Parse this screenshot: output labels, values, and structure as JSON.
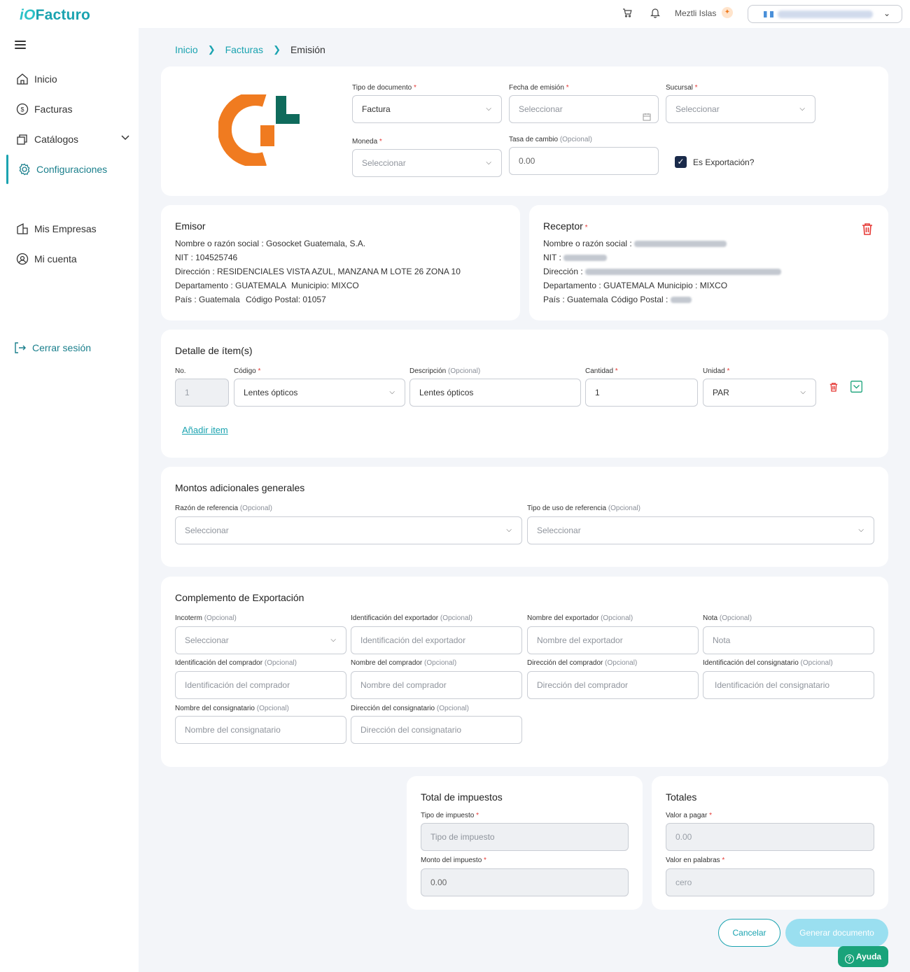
{
  "app": {
    "logo_prefix": "iO",
    "logo_text": "Facturo"
  },
  "header": {
    "user_name": "Meztli Islas",
    "company_name": "Gosocket Guatemala, S.A."
  },
  "sidebar": {
    "items": [
      {
        "label": "Inicio"
      },
      {
        "label": "Facturas"
      },
      {
        "label": "Catálogos"
      },
      {
        "label": "Configuraciones"
      },
      {
        "label": "Mis Empresas"
      },
      {
        "label": "Mi cuenta"
      }
    ],
    "logout": "Cerrar sesión"
  },
  "breadcrumb": [
    "Inicio",
    "Facturas",
    "Emisión"
  ],
  "doc": {
    "tipo_label": "Tipo de documento",
    "tipo_value": "Factura",
    "fecha_label": "Fecha de emisión",
    "fecha_placeholder": "Seleccionar",
    "sucursal_label": "Sucursal",
    "sucursal_placeholder": "Seleccionar",
    "moneda_label": "Moneda",
    "moneda_placeholder": "Seleccionar",
    "tasa_label": "Tasa de cambio",
    "tasa_value": "0.00",
    "opcional": "(Opcional)",
    "exportacion_label": "Es Exportación?"
  },
  "emisor": {
    "title": "Emisor",
    "nombre": "Nombre o razón social : Gosocket Guatemala, S.A.",
    "nit": "NIT : 104525746",
    "direccion": "Dirección : RESIDENCIALES VISTA AZUL, MANZANA M LOTE 26 ZONA 10",
    "departamento": "Departamento : GUATEMALA",
    "municipio": "Municipio: MIXCO",
    "pais": "País : Guatemala",
    "codigo_postal": "Código Postal: 01057"
  },
  "receptor": {
    "title": "Receptor",
    "nombre_label": "Nombre o razón social :",
    "nit_label": "NIT :",
    "direccion_label": "Dirección :",
    "departamento": "Departamento : GUATEMALA",
    "municipio": "Municipio : MIXCO",
    "pais": "País : Guatemala",
    "codigo_postal_label": "Código Postal :"
  },
  "items": {
    "title": "Detalle de ítem(s)",
    "col_no": "No.",
    "col_codigo": "Código",
    "col_descripcion": "Descripción",
    "col_cantidad": "Cantidad",
    "col_unidad": "Unidad",
    "row": {
      "no": "1",
      "codigo": "Lentes ópticos",
      "descripcion": "Lentes ópticos",
      "cantidad": "1",
      "unidad": "PAR"
    },
    "add_link": "Añadir item"
  },
  "montos": {
    "title": "Montos adicionales generales",
    "razon_label": "Razón de referencia",
    "razon_placeholder": "Seleccionar",
    "tipo_uso_label": "Tipo de uso de referencia",
    "tipo_uso_placeholder": "Seleccionar"
  },
  "export": {
    "title": "Complemento de Exportación",
    "fields": [
      {
        "label": "Incoterm",
        "placeholder": "Seleccionar"
      },
      {
        "label": "Identificación del exportador",
        "placeholder": "Identificación del exportador"
      },
      {
        "label": "Nombre del exportador",
        "placeholder": "Nombre del exportador"
      },
      {
        "label": "Nota",
        "placeholder": "Nota"
      },
      {
        "label": "Identificación del comprador",
        "placeholder": "Identificación del comprador"
      },
      {
        "label": "Nombre del comprador",
        "placeholder": "Nombre del comprador"
      },
      {
        "label": "Dirección del comprador",
        "placeholder": "Dirección del comprador"
      },
      {
        "label": "Identificación del consignatario",
        "placeholder": "Identificación del consignatario"
      },
      {
        "label": "Nombre del consignatario",
        "placeholder": "Nombre del consignatario"
      },
      {
        "label": "Dirección del consignatario",
        "placeholder": "Dirección del consignatario"
      }
    ]
  },
  "impuestos": {
    "title": "Total de impuestos",
    "tipo_label": "Tipo de impuesto",
    "tipo_placeholder": "Tipo de impuesto",
    "monto_label": "Monto del impuesto",
    "monto_value": "0.00"
  },
  "totales": {
    "title": "Totales",
    "valor_label": "Valor a pagar",
    "valor_value": "0.00",
    "palabras_label": "Valor en palabras",
    "palabras_value": "cero"
  },
  "actions": {
    "cancel": "Cancelar",
    "generate": "Generar documento",
    "help": "Ayuda"
  },
  "colors": {
    "brand": "#1aa3b0",
    "danger": "#e53935",
    "logo_orange": "#f07b20",
    "logo_green": "#0f6b5c",
    "help_green": "#1aa37a"
  }
}
